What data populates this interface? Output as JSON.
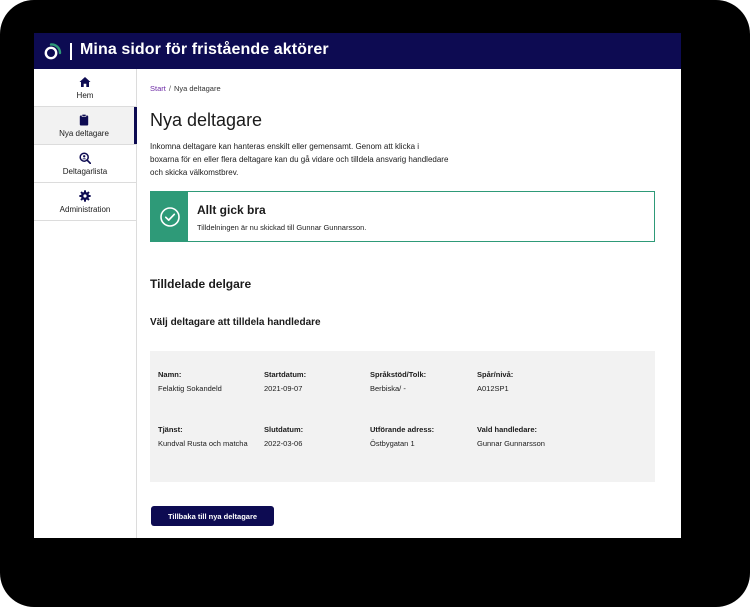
{
  "header": {
    "title": "Mina sidor för fristående aktörer",
    "brand_color": "#0d0b52",
    "logo_accent": "#2e9a78"
  },
  "sidebar": {
    "items": [
      {
        "label": "Hem",
        "icon": "home-icon",
        "active": false
      },
      {
        "label": "Nya deltagare",
        "icon": "clipboard-icon",
        "active": true
      },
      {
        "label": "Deltagarlista",
        "icon": "user-search-icon",
        "active": false
      },
      {
        "label": "Administration",
        "icon": "gear-icon",
        "active": false
      }
    ]
  },
  "breadcrumb": {
    "start": "Start",
    "separator": "/",
    "current": "Nya deltagare"
  },
  "page": {
    "title": "Nya deltagare",
    "intro": "Inkomna deltagare kan hanteras enskilt eller gemensamt. Genom att klicka i boxarna för en eller flera deltagare kan du gå vidare och tilldela ansvarig handledare och skicka välkomstbrev."
  },
  "alert": {
    "title": "Allt gick bra",
    "text": "Tilldelningen är nu skickad till Gunnar Gunnarsson.",
    "color": "#2e9a78",
    "icon": "check-circle-icon"
  },
  "section": {
    "title": "Tilldelade delgare",
    "subtitle": "Välj deltagare att tilldela handledare"
  },
  "participant": {
    "name": {
      "label": "Namn:",
      "value": "Felaktig Sokandeld"
    },
    "start": {
      "label": "Startdatum:",
      "value": "2021-09-07"
    },
    "language": {
      "label": "Språkstöd/Tolk:",
      "value": "Berbiska/ -"
    },
    "track": {
      "label": "Spår/nivå:",
      "value": "A012SP1"
    },
    "service": {
      "label": "Tjänst:",
      "value": "Kundval Rusta och matcha"
    },
    "end": {
      "label": "Slutdatum:",
      "value": "2022-03-06"
    },
    "address": {
      "label": "Utförande adress:",
      "value": "Östbygatan 1"
    },
    "supervisor": {
      "label": "Vald handledare:",
      "value": "Gunnar Gunnarsson"
    }
  },
  "actions": {
    "back_label": "Tillbaka till nya deltagare"
  }
}
